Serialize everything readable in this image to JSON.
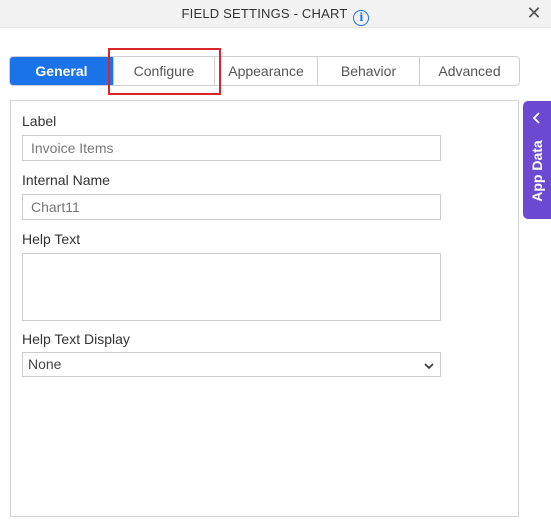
{
  "header": {
    "title": "FIELD SETTINGS - CHART",
    "info_icon": "i",
    "close_icon": "✕"
  },
  "tabs": [
    {
      "label": "General",
      "active": true
    },
    {
      "label": "Configure",
      "active": false
    },
    {
      "label": "Appearance",
      "active": false
    },
    {
      "label": "Behavior",
      "active": false
    },
    {
      "label": "Advanced",
      "active": false
    }
  ],
  "form": {
    "label": {
      "label": "Label",
      "value": "Invoice Items"
    },
    "internal_name": {
      "label": "Internal Name",
      "value": "Chart11"
    },
    "help_text": {
      "label": "Help Text",
      "value": ""
    },
    "help_text_display": {
      "label": "Help Text Display",
      "selected": "None"
    }
  },
  "side_panel": {
    "label": "App Data"
  },
  "colors": {
    "accent": "#1a73e8",
    "side_panel": "#6b4ad1",
    "highlight": "#d9262c"
  }
}
